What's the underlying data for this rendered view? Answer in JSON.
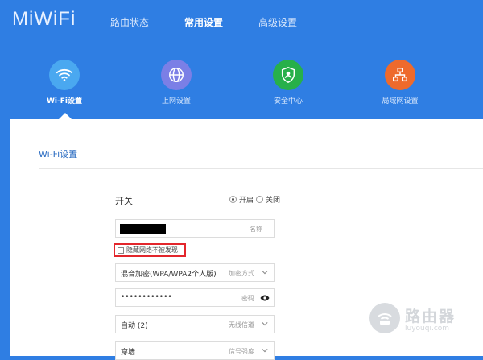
{
  "header": {
    "logo": "MiWiFi",
    "tabs": [
      {
        "label": "路由状态",
        "active": false
      },
      {
        "label": "常用设置",
        "active": true
      },
      {
        "label": "高级设置",
        "active": false
      }
    ]
  },
  "quick_nav": [
    {
      "label": "Wi-Fi设置",
      "icon": "wifi-icon",
      "color": "#4aa8f0",
      "active": true
    },
    {
      "label": "上网设置",
      "icon": "globe-icon",
      "color": "#7b7fe6",
      "active": false
    },
    {
      "label": "安全中心",
      "icon": "shield-icon",
      "color": "#27b04a",
      "active": false
    },
    {
      "label": "局域网设置",
      "icon": "network-icon",
      "color": "#ee6a2c",
      "active": false
    }
  ],
  "panel": {
    "title": "Wi-Fi设置",
    "switch": {
      "label": "开关",
      "options": [
        "开启",
        "关闭"
      ],
      "selected": "开启"
    },
    "name_field": {
      "value": "",
      "hint": "名称"
    },
    "hide_network": {
      "label": "隐藏网络不被发现",
      "checked": false
    },
    "encryption": {
      "value": "混合加密(WPA/WPA2个人版)",
      "hint": "加密方式"
    },
    "password": {
      "value": "••••••••••••",
      "hint": "密码"
    },
    "channel": {
      "value": "自动 (2)",
      "hint": "无线信道"
    },
    "signal": {
      "value": "穿墙",
      "hint": "信号强度"
    }
  },
  "watermark": {
    "title": "路由器",
    "subtitle": "luyouqi.com"
  },
  "colors": {
    "header_bg": "#2f7ee3",
    "accent_blue": "#2f6fc3",
    "highlight_red": "#e3262c"
  }
}
